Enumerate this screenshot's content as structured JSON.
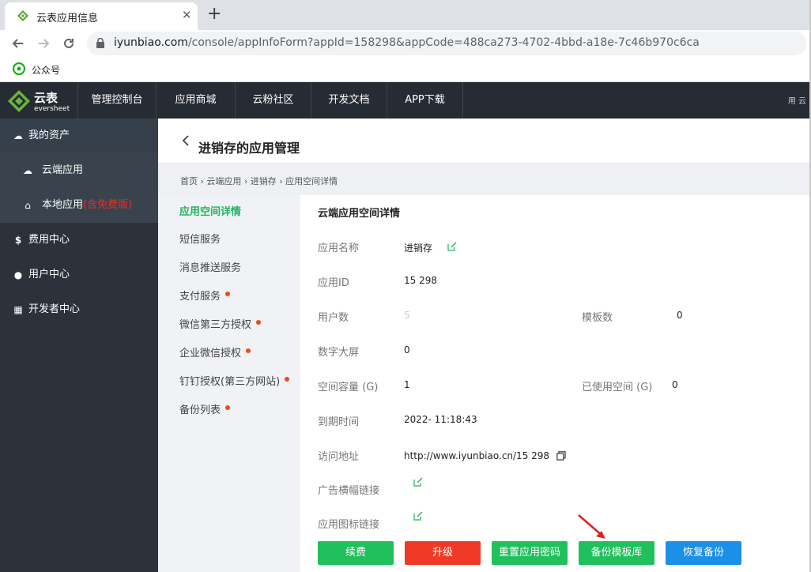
{
  "browser": {
    "tab_title": "云表应用信息",
    "tab_close": "✕",
    "new_tab": "+",
    "url_host": "iyunbiao.com",
    "url_path": "/console/appInfoForm?appId=158298&appCode=488ca273-4702-4bbd-a18e-7c46b970c6ca",
    "bookmark_label": "公众号"
  },
  "header": {
    "logo_text": "云表",
    "logo_sub": "eversheet",
    "nav": [
      "管理控制台",
      "应用商城",
      "云粉社区",
      "开发文档",
      "APP下载"
    ],
    "right_text": "用 云"
  },
  "sidebar": {
    "my_assets": "我的资产",
    "cloud_app": "云端应用",
    "local_app": "本地应用",
    "local_tag": "(含免费版)",
    "finance": "费用中心",
    "user": "用户中心",
    "developer": "开发者中心"
  },
  "page": {
    "title": "进销存的应用管理",
    "breadcrumb": "首页 › 云端应用 › 进销存 › 应用空间详情"
  },
  "left_menu": [
    {
      "label": "应用空间详情",
      "active": true,
      "dot": false
    },
    {
      "label": "短信服务",
      "active": false,
      "dot": false
    },
    {
      "label": "消息推送服务",
      "active": false,
      "dot": false
    },
    {
      "label": "支付服务",
      "active": false,
      "dot": true
    },
    {
      "label": "微信第三方授权",
      "active": false,
      "dot": true
    },
    {
      "label": "企业微信授权",
      "active": false,
      "dot": true
    },
    {
      "label": "钉钉授权(第三方网站)",
      "active": false,
      "dot": true
    },
    {
      "label": "备份列表",
      "active": false,
      "dot": true
    }
  ],
  "detail": {
    "title": "云端应用空间详情",
    "app_name_label": "应用名称",
    "app_name_value": "进销存",
    "app_id_label": "应用ID",
    "app_id_value": "15 298",
    "user_count_label": "用户数",
    "user_count_value": "5",
    "template_count_label": "模板数",
    "template_count_value": "0",
    "big_screen_label": "数字大屏",
    "big_screen_value": "0",
    "space_label": "空间容量 (G)",
    "space_value": "1",
    "used_label": "已使用空间 (G)",
    "used_value": "0",
    "expire_label": "到期时间",
    "expire_value": "2022-          11:18:43",
    "access_label": "访问地址",
    "access_value": "http://www.iyunbiao.cn/15  298",
    "banner_label": "广告横幅链接",
    "icon_link_label": "应用图标链接"
  },
  "buttons": {
    "renew": "续费",
    "upgrade": "升级",
    "reset_password": "重置应用密码",
    "backup_template": "备份模板库",
    "restore_backup": "恢复备份"
  },
  "colors": {
    "header_bg": "#262c33",
    "sidebar_bg": "#2b323a",
    "accent_green": "#20c05c",
    "upgrade_red": "#f03a27",
    "restore_blue": "#1c8fe6",
    "dot_orange": "#f04a16"
  }
}
